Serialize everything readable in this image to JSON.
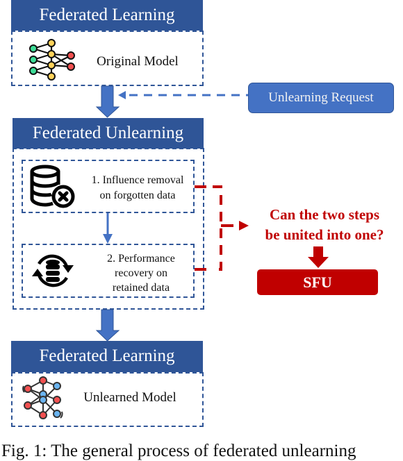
{
  "colors": {
    "primary_blue": "#2f5597",
    "light_blue": "#4472c4",
    "red": "#c00000"
  },
  "top_block": {
    "header": "Federated Learning",
    "icon": "neural-network-icon",
    "label": "Original Model"
  },
  "request": {
    "label": "Unlearning Request"
  },
  "middle_block": {
    "header": "Federated Unlearning",
    "steps": [
      {
        "icon": "database-remove-icon",
        "line1": "1. Influence removal",
        "line2": "on forgotten data"
      },
      {
        "icon": "database-sync-icon",
        "line1": "2. Performance",
        "line2": "recovery on",
        "line3": "retained data"
      }
    ]
  },
  "question": {
    "line1": "Can the two steps",
    "line2": "be united into one?"
  },
  "result": {
    "label": "SFU"
  },
  "bottom_block": {
    "header": "Federated Learning",
    "icon": "unlearned-network-icon",
    "label": "Unlearned Model"
  },
  "caption": "Fig. 1: The general process of federated unlearning"
}
